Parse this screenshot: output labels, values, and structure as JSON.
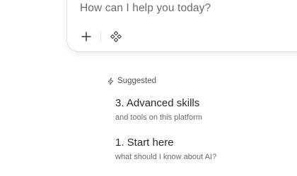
{
  "composer": {
    "placeholder": "How can I help you today?",
    "add_icon": "plus-icon",
    "tools_icon": "sparkle-diamond-icon"
  },
  "suggested": {
    "header": "Suggested",
    "header_icon": "bolt-icon",
    "items": [
      {
        "title": "3. Advanced skills",
        "subtitle": "and tools on this platform"
      },
      {
        "title": "1. Start here",
        "subtitle": "what should I know about AI?"
      }
    ]
  },
  "colors": {
    "text_primary": "#2b2b2b",
    "text_secondary": "#6a6a6a",
    "border": "#e2e2e2"
  }
}
